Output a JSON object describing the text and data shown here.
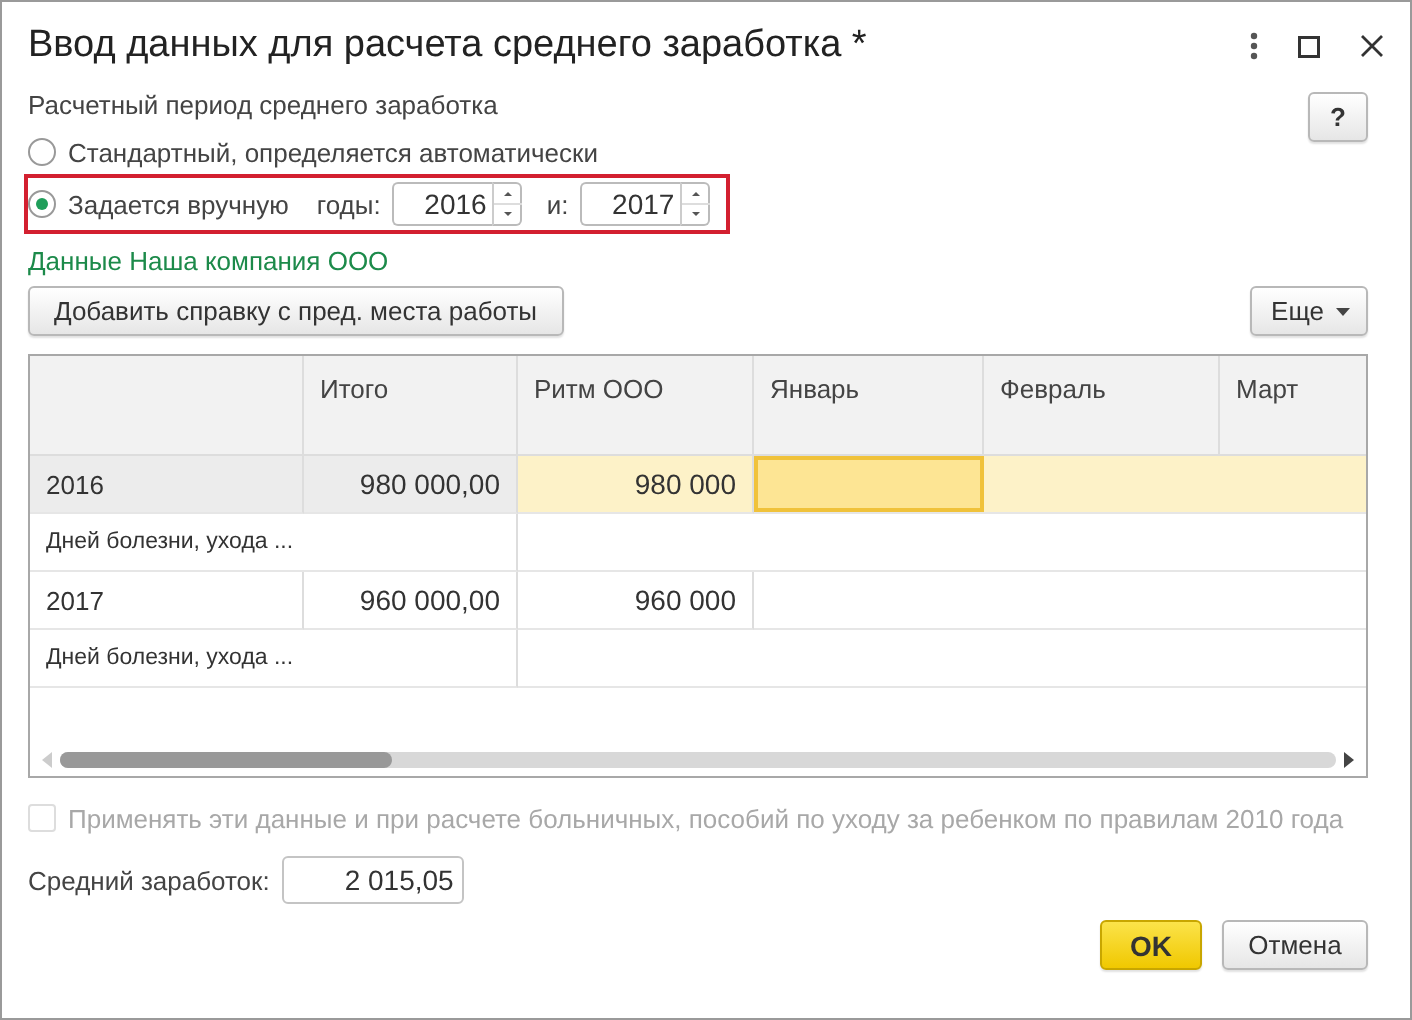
{
  "window": {
    "title": "Ввод данных для расчета среднего заработка *"
  },
  "help_button": "?",
  "period": {
    "label": "Расчетный период среднего заработка",
    "options": [
      {
        "label": "Стандартный, определяется автоматически",
        "selected": false
      },
      {
        "label": "Задается вручную",
        "selected": true
      }
    ],
    "years_label": "годы:",
    "year_from": "2016",
    "and_label": "и:",
    "year_to": "2017"
  },
  "company_link": "Данные Наша компания ООО",
  "add_button": "Добавить справку с пред. места работы",
  "more_button": "Еще",
  "table": {
    "columns": [
      "Итого",
      "Ритм ООО",
      "Январь",
      "Февраль",
      "Март"
    ],
    "rows": [
      {
        "kind": "year",
        "label": "2016",
        "total": "980 000,00",
        "selected": true,
        "cells": [
          {
            "value": "980 000",
            "selected": false
          },
          {
            "selected": true
          },
          {
            "selected": false
          },
          {
            "selected": false
          }
        ]
      },
      {
        "kind": "note",
        "label": "Дней болезни, ухода ..."
      },
      {
        "kind": "year",
        "label": "2017",
        "total": "960 000,00",
        "selected": false,
        "cells": [
          {
            "value": "960 000",
            "selected": false
          },
          {
            "selected": false
          },
          {
            "selected": false
          },
          {
            "selected": false
          }
        ]
      },
      {
        "kind": "note",
        "label": "Дней болезни, ухода ..."
      }
    ]
  },
  "checkbox": {
    "label": "Применять эти данные и при расчете больничных, пособий по уходу за ребенком по правилам 2010 года",
    "checked": false,
    "disabled": true
  },
  "average": {
    "label": "Средний заработок:",
    "value": "2 015,05"
  },
  "buttons": {
    "ok": "OK",
    "cancel": "Отмена"
  }
}
